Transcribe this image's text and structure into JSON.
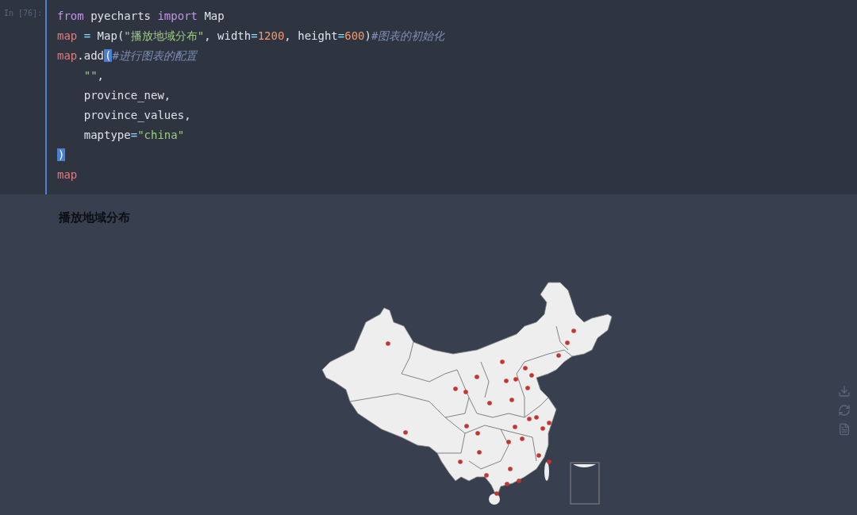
{
  "cell": {
    "prompt": "In [76]:",
    "lines": [
      {
        "tokens": [
          {
            "text": "from",
            "kind": "keyword"
          },
          {
            "text": " pyecharts ",
            "kind": "plain"
          },
          {
            "text": "import",
            "kind": "keyword"
          },
          {
            "text": " Map",
            "kind": "plain"
          }
        ]
      },
      {
        "tokens": [
          {
            "text": "map",
            "kind": "variable"
          },
          {
            "text": " = ",
            "kind": "operator"
          },
          {
            "text": "Map(",
            "kind": "plain"
          },
          {
            "text": "\"播放地域分布\"",
            "kind": "string"
          },
          {
            "text": ", width",
            "kind": "plain"
          },
          {
            "text": "=",
            "kind": "operator"
          },
          {
            "text": "1200",
            "kind": "number"
          },
          {
            "text": ", height",
            "kind": "plain"
          },
          {
            "text": "=",
            "kind": "operator"
          },
          {
            "text": "600",
            "kind": "number"
          },
          {
            "text": ")",
            "kind": "plain"
          },
          {
            "text": "#图表的初始化",
            "kind": "comment"
          }
        ]
      },
      {
        "tokens": [
          {
            "text": "map",
            "kind": "variable"
          },
          {
            "text": ".add",
            "kind": "plain"
          },
          {
            "text": "(",
            "kind": "match"
          },
          {
            "text": "#进行图表的配置",
            "kind": "comment"
          }
        ]
      },
      {
        "tokens": [
          {
            "text": "    \"\"",
            "kind": "string"
          },
          {
            "text": ",",
            "kind": "plain"
          }
        ]
      },
      {
        "tokens": [
          {
            "text": "    province_new,",
            "kind": "plain"
          }
        ]
      },
      {
        "tokens": [
          {
            "text": "    province_values,",
            "kind": "plain"
          }
        ]
      },
      {
        "tokens": [
          {
            "text": "    maptype",
            "kind": "plain"
          },
          {
            "text": "=",
            "kind": "operator"
          },
          {
            "text": "\"china\"",
            "kind": "string"
          }
        ]
      },
      {
        "tokens": [
          {
            "text": ")",
            "kind": "match"
          }
        ]
      },
      {
        "tokens": [
          {
            "text": "map",
            "kind": "variable"
          }
        ]
      }
    ]
  },
  "output": {
    "chart_title": "播放地域分布"
  }
}
